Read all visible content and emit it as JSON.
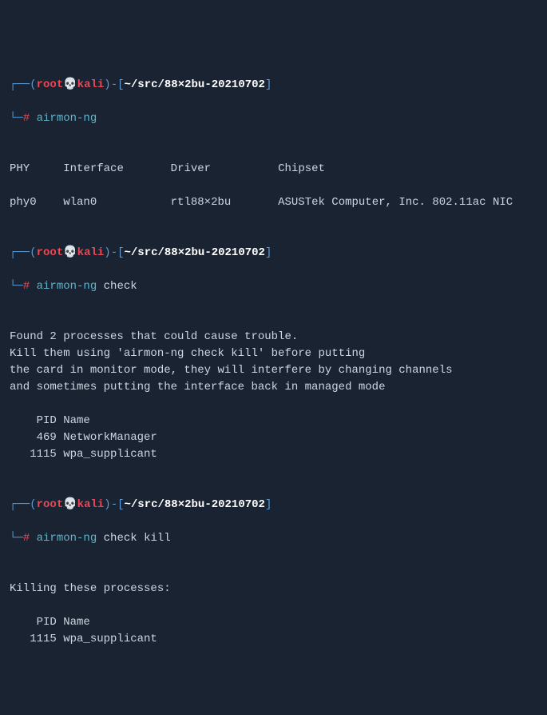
{
  "prompt1": {
    "corner_top": "┌──",
    "paren_open": "(",
    "user": "root",
    "skull": "💀",
    "host": "kali",
    "paren_close": ")",
    "dash": "-",
    "bracket_open": "[",
    "path": "~/src/88×2bu-20210702",
    "bracket_close": "]",
    "corner_bottom": "└─",
    "hash": "#",
    "command": "airmon-ng"
  },
  "table1": {
    "header": {
      "col1": "PHY",
      "col2": "Interface",
      "col3": "Driver",
      "col4": "Chipset"
    },
    "row": {
      "col1": "phy0",
      "col2": "wlan0",
      "col3": "rtl88×2bu",
      "col4": "ASUSTek Computer, Inc. 802.11ac NIC"
    }
  },
  "prompt2": {
    "corner_top": "┌──",
    "paren_open": "(",
    "user": "root",
    "skull": "💀",
    "host": "kali",
    "paren_close": ")",
    "dash": "-",
    "bracket_open": "[",
    "path": "~/src/88×2bu-20210702",
    "bracket_close": "]",
    "corner_bottom": "└─",
    "hash": "#",
    "command": "airmon-ng",
    "args": "check"
  },
  "output2": {
    "line1": "Found 2 processes that could cause trouble.",
    "line2": "Kill them using 'airmon-ng check kill' before putting",
    "line3": "the card in monitor mode, they will interfere by changing channels",
    "line4": "and sometimes putting the interface back in managed mode",
    "header": "    PID Name",
    "row1": "    469 NetworkManager",
    "row2": "   1115 wpa_supplicant"
  },
  "prompt3": {
    "corner_top": "┌──",
    "paren_open": "(",
    "user": "root",
    "skull": "💀",
    "host": "kali",
    "paren_close": ")",
    "dash": "-",
    "bracket_open": "[",
    "path": "~/src/88×2bu-20210702",
    "bracket_close": "]",
    "corner_bottom": "└─",
    "hash": "#",
    "command": "airmon-ng",
    "args": "check kill"
  },
  "output3": {
    "line1": "Killing these processes:",
    "header": "    PID Name",
    "row1": "   1115 wpa_supplicant"
  }
}
